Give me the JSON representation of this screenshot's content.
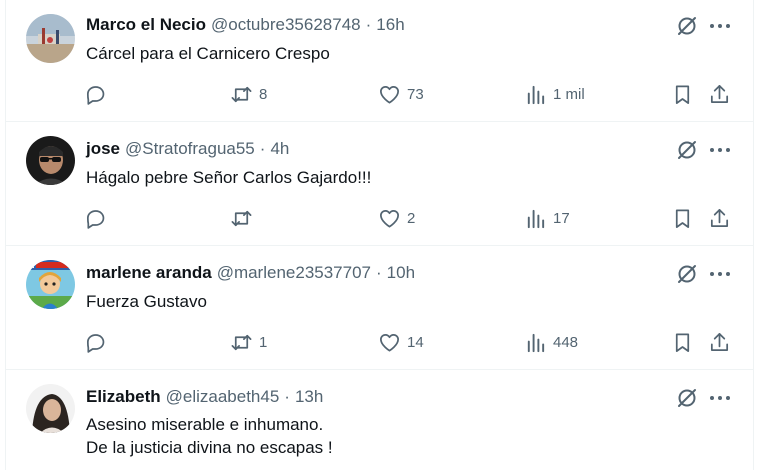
{
  "tweets": [
    {
      "name": "Marco el Necio",
      "handle": "@octubre35628748",
      "time": "16h",
      "lines": [
        "Cárcel para el Carnicero Crespo"
      ],
      "replies": "",
      "retweets": "8",
      "likes": "73",
      "views": "1 mil"
    },
    {
      "name": "jose",
      "handle": "@Stratofragua55",
      "time": "4h",
      "lines": [
        "Hágalo pebre Señor Carlos Gajardo!!!"
      ],
      "replies": "",
      "retweets": "",
      "likes": "2",
      "views": "17"
    },
    {
      "name": "marlene aranda",
      "handle": "@marlene23537707",
      "time": "10h",
      "lines": [
        "Fuerza Gustavo"
      ],
      "replies": "",
      "retweets": "1",
      "likes": "14",
      "views": "448"
    },
    {
      "name": "Elizabeth",
      "handle": "@elizaabeth45",
      "time": "13h",
      "lines": [
        "Asesino miserable e inhumano.",
        "De la justicia divina no escapas !"
      ]
    }
  ],
  "separator": "·",
  "icons": {
    "reply": "reply-icon",
    "retweet": "retweet-icon",
    "like": "heart-icon",
    "views": "views-icon",
    "bookmark": "bookmark-icon",
    "share": "share-icon",
    "grok": "grok-icon",
    "more": "more-icon"
  },
  "colors": {
    "text": "#0f1419",
    "secondary": "#536471",
    "divider": "#eff3f4"
  }
}
